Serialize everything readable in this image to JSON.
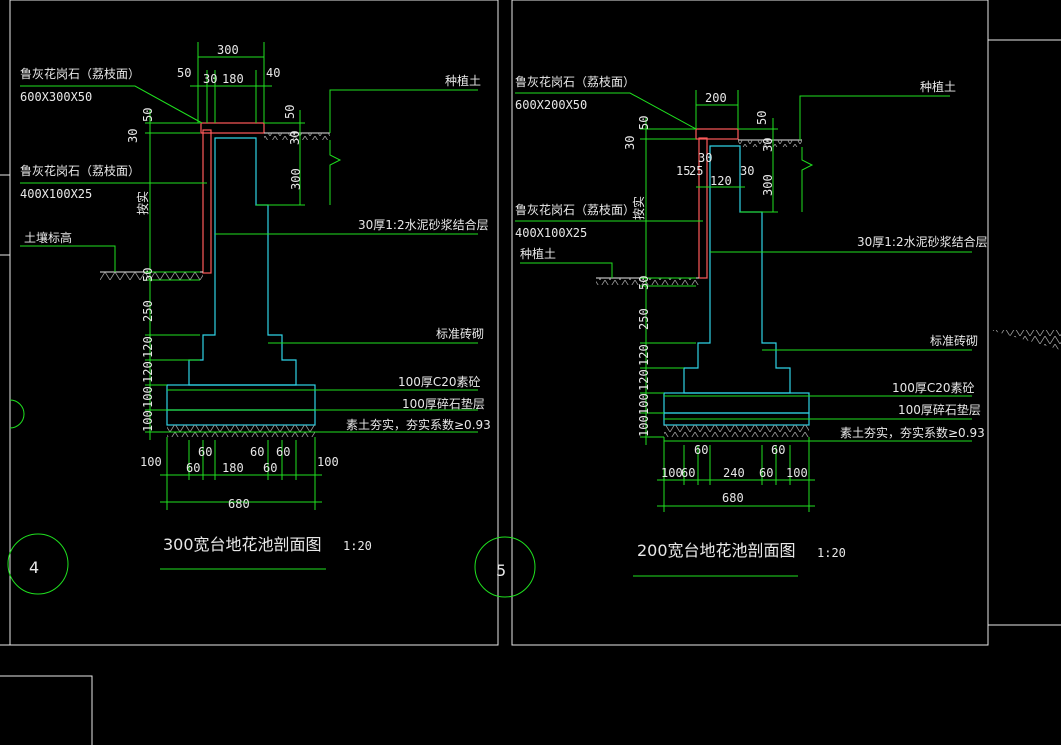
{
  "left": {
    "label_cap": "鲁灰花岗石（荔枝面）",
    "cap_size": "600X300X50",
    "label_facing": "鲁灰花岗石（荔枝面）",
    "facing_size": "400X100X25",
    "label_soil_level": "土壤标高",
    "label_topsoil": "种植土",
    "label_mortar": "30厚1:2水泥砂浆结合层",
    "label_brick": "标准砖砌",
    "label_concrete": "100厚C20素砼",
    "label_gravel": "100厚碎石垫层",
    "label_compact": "素土夯实，夯实系数≥0.93",
    "label_variable": "按实",
    "dim_top_total": "300",
    "dim_top_a": "50",
    "dim_top_b": "30",
    "dim_top_c": "180",
    "dim_top_d": "40",
    "dim_cap_h": "50",
    "dim_left_30": "30",
    "dim_left_50a": "50",
    "dim_right_30": "30",
    "dim_right_300": "300",
    "dim_left_50b": "50",
    "dim_250": "250",
    "dim_120a": "120",
    "dim_120b": "120",
    "dim_100a": "100",
    "dim_100b": "100",
    "dim_b_60a": "60",
    "dim_b_60b": "60",
    "dim_b_180": "180",
    "dim_b_60c": "60",
    "dim_b_60d": "60",
    "dim_b_60e": "60",
    "dim_b_100l": "100",
    "dim_b_100r": "100",
    "dim_b_total": "680",
    "title": "300宽台地花池剖面图",
    "scale": "1:20",
    "bubble": "4"
  },
  "right": {
    "label_cap": "鲁灰花岗石（荔枝面）",
    "cap_size": "600X200X50",
    "label_facing": "鲁灰花岗石（荔枝面）",
    "facing_size": "400X100X25",
    "label_topsoil_left": "种植土",
    "label_topsoil": "种植土",
    "label_mortar": "30厚1:2水泥砂浆结合层",
    "label_brick": "标准砖砌",
    "label_concrete": "100厚C20素砼",
    "label_gravel": "100厚碎石垫层",
    "label_compact": "素土夯实，夯实系数≥0.93",
    "label_variable": "按实",
    "dim_top_total": "200",
    "dim_cap_h": "50",
    "dim_left_30": "30",
    "dim_left_50a": "50",
    "dim_15": "15",
    "dim_25": "25",
    "dim_30a": "30",
    "dim_30b": "30",
    "dim_120": "120",
    "dim_right_30": "30",
    "dim_right_300": "300",
    "dim_left_50b": "50",
    "dim_250": "250",
    "dim_120a": "120",
    "dim_120b": "120",
    "dim_100a": "100",
    "dim_100b": "100",
    "dim_b_60a": "60",
    "dim_b_60b": "60",
    "dim_b_100l": "100",
    "dim_b_60l": "60",
    "dim_b_240": "240",
    "dim_b_60r": "60",
    "dim_b_100r": "100",
    "dim_b_total": "680",
    "title": "200宽台地花池剖面图",
    "scale": "1:20",
    "bubble": "5"
  },
  "colors": {
    "line": "#1fe01f",
    "section": "#2fd3e6",
    "granite": "#ff5a5a",
    "text": "#e8e8e8"
  }
}
